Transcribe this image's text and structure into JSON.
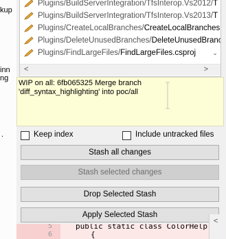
{
  "left_strip": {
    "fragments": [
      "kup",
      "inn",
      "ng",
      "."
    ]
  },
  "file_list": {
    "rows": [
      {
        "dir": "Plugins/BuildServerIntegration/TfsInterop.Vs2012/",
        "name": "T"
      },
      {
        "dir": "Plugins/BuildServerIntegration/TfsInterop.Vs2013/",
        "name": "T"
      },
      {
        "dir": "Plugins/CreateLocalBranches/",
        "name": "CreateLocalBranches.c"
      },
      {
        "dir": "Plugins/DeleteUnusedBranches/",
        "name": "DeleteUnusedBrancl"
      },
      {
        "dir": "Plugins/FindLargeFiles/",
        "name": "FindLargeFiles.csproj"
      }
    ],
    "scroll_down_glyph": "⌄",
    "scroll_left_glyph": "<",
    "scroll_right_glyph": ">"
  },
  "preview": {
    "line1": "WIP on all: 6fb065325 Merge branch",
    "line2": "'diff_syntax_highlighting' into poc/all"
  },
  "options": {
    "keep_index": {
      "label": "Keep index",
      "checked": false
    },
    "include_untracked": {
      "label": "Include untracked files",
      "checked": false
    }
  },
  "buttons": {
    "stash_all": "Stash all changes",
    "stash_selected": "Stash selected changes",
    "drop_selected": "Drop Selected Stash",
    "apply_selected": "Apply Selected Stash"
  },
  "editor": {
    "line_num_1": "5",
    "line_num_2": "6",
    "code_1": "public static class ColorHelp",
    "code_2": "{",
    "scroll_glyph": "<"
  },
  "colors": {
    "preview_bg": "#fdfdd6",
    "pencil": "#e8a838",
    "editor_gutter": "#f8d0d0"
  }
}
